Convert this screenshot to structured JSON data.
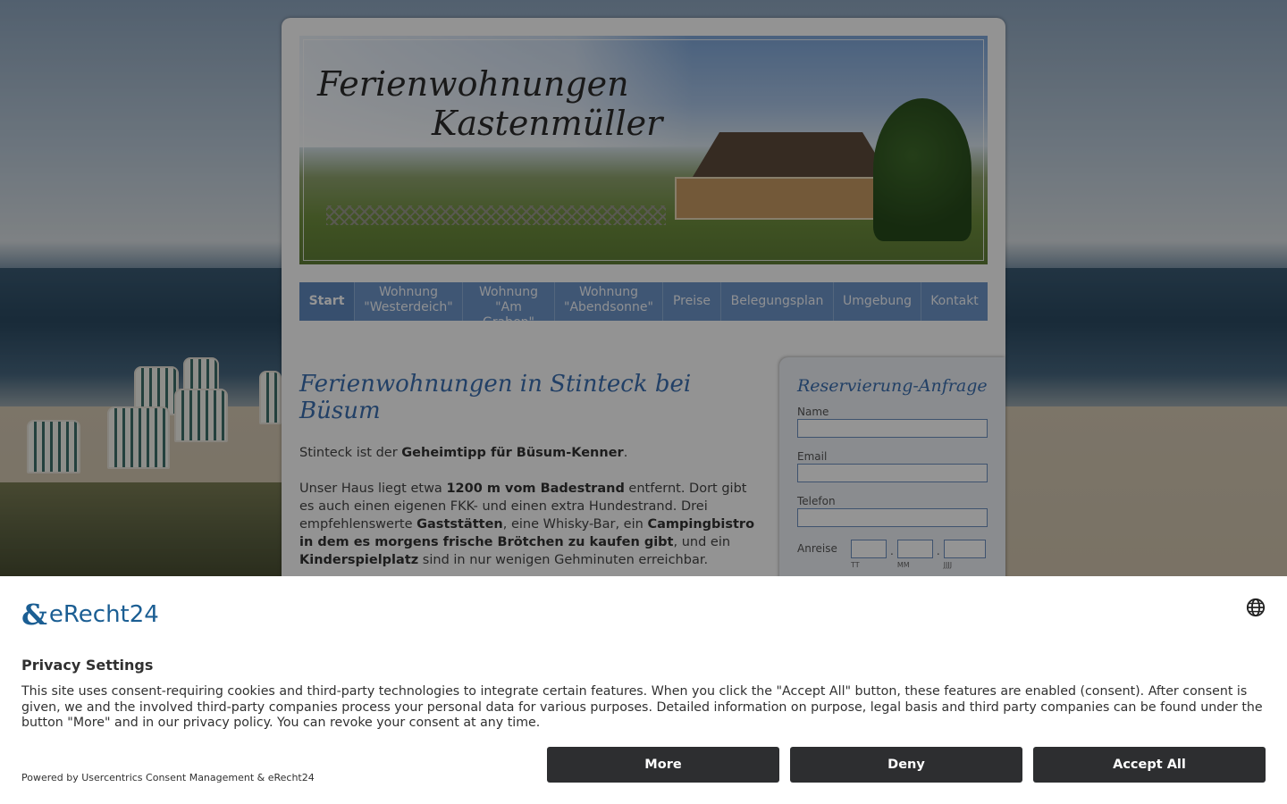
{
  "site": {
    "header_title_line1": "Ferienwohnungen",
    "header_title_line2": "Kastenmüller"
  },
  "nav": {
    "items": [
      {
        "label": "Start",
        "active": true
      },
      {
        "label": "Wohnung \"Westerdeich\""
      },
      {
        "label": "Wohnung \"Am Graben\""
      },
      {
        "label": "Wohnung \"Abendsonne\""
      },
      {
        "label": "Preise"
      },
      {
        "label": "Belegungsplan"
      },
      {
        "label": "Umgebung"
      },
      {
        "label": "Kontakt"
      }
    ]
  },
  "main": {
    "heading": "Ferienwohnungen in Stinteck bei Büsum",
    "p1": {
      "t1": "Stinteck ist der ",
      "b1": "Geheimtipp für Büsum-Kenner",
      "t2": "."
    },
    "p2": {
      "t1": "Unser Haus liegt etwa ",
      "b1": "1200 m vom Badestrand",
      "t2": " entfernt. Dort gibt es auch einen eigenen FKK- und einen extra Hundestrand. Drei empfehlenswerte ",
      "b2": "Gaststätten",
      "t3": ", eine Whisky-Bar, ein ",
      "b3": "Campingbistro in dem es morgens frische Brötchen zu kaufen gibt",
      "t4": ", und ein ",
      "b4": "Kinderspielplatz",
      "t5": " sind in nur wenigen Gehminuten erreichbar."
    }
  },
  "sidebar": {
    "title": "Reservierung-Anfrage",
    "name_label": "Name",
    "email_label": "Email",
    "phone_label": "Telefon",
    "arrival_label": "Anreise",
    "date_hints": [
      "TT",
      "MM",
      "JJJJ"
    ],
    "date_separator": "."
  },
  "consent": {
    "brand": "eRecht24",
    "brand_icon": "erecht24-logo-icon",
    "title": "Privacy Settings",
    "description": "This site uses consent-requiring cookies and third-party technologies to integrate certain features. When you click the \"Accept All\" button, these features are enabled (consent). After consent is given, we and the involved third-party companies process your personal data for various purposes. Detailed information on purpose, legal basis and third party companies can be found under the button \"More\" and in our privacy policy. You can revoke your consent at any time.",
    "powered_by": "Powered by Usercentrics Consent Management & eRecht24",
    "buttons": {
      "more": "More",
      "deny": "Deny",
      "accept": "Accept All"
    },
    "language_icon": "globe-icon"
  },
  "colors": {
    "nav_bg": "#6d95c9",
    "heading": "#3b6fb0",
    "button_bg": "#2d2e30",
    "brand": "#1b5e93"
  }
}
